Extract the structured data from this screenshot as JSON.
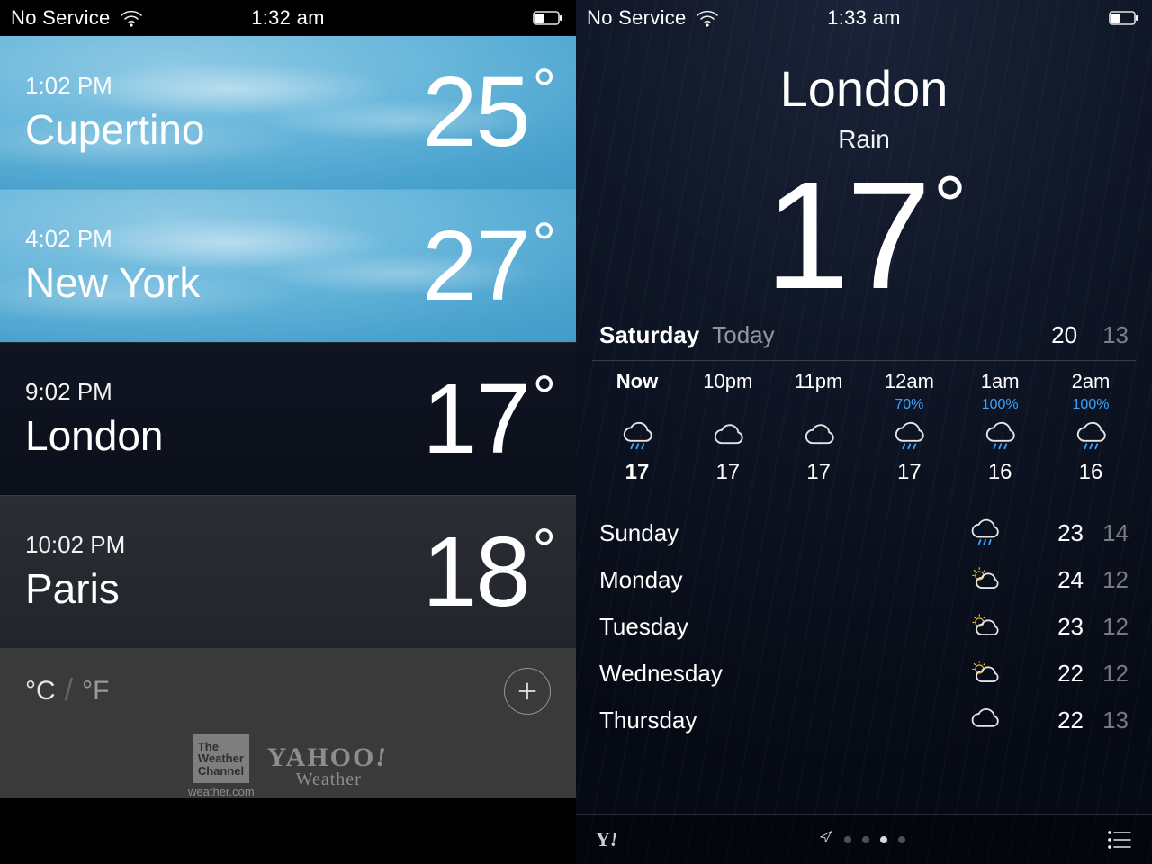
{
  "status_left": {
    "carrier": "No Service",
    "time": "1:32 am"
  },
  "status_right": {
    "carrier": "No Service",
    "time": "1:33 am"
  },
  "list": {
    "cities": [
      {
        "time": "1:02 PM",
        "name": "Cupertino",
        "temp": "25",
        "bg": "sky"
      },
      {
        "time": "4:02 PM",
        "name": "New York",
        "temp": "27",
        "bg": "sky"
      },
      {
        "time": "9:02 PM",
        "name": "London",
        "temp": "17",
        "bg": "dark-rain"
      },
      {
        "time": "10:02 PM",
        "name": "Paris",
        "temp": "18",
        "bg": "dark-cloud"
      }
    ],
    "unit_c": "°C",
    "unit_f": "°F",
    "credits": {
      "twc_line1": "The",
      "twc_line2": "Weather",
      "twc_line3": "Channel",
      "twc_sub": "weather.com",
      "yahoo_top": "YAHOO",
      "yahoo_bang": "!",
      "yahoo_bottom": "Weather"
    }
  },
  "detail": {
    "city": "London",
    "condition": "Rain",
    "temp": "17",
    "today": {
      "day": "Saturday",
      "label": "Today",
      "hi": "20",
      "lo": "13"
    },
    "hourly": [
      {
        "label": "Now",
        "precip": "",
        "icon": "rain",
        "temp": "17",
        "now": true
      },
      {
        "label": "10pm",
        "precip": "",
        "icon": "cloud",
        "temp": "17",
        "now": false
      },
      {
        "label": "11pm",
        "precip": "",
        "icon": "cloud",
        "temp": "17",
        "now": false
      },
      {
        "label": "12am",
        "precip": "70%",
        "icon": "rain",
        "temp": "17",
        "now": false
      },
      {
        "label": "1am",
        "precip": "100%",
        "icon": "rain",
        "temp": "16",
        "now": false
      },
      {
        "label": "2am",
        "precip": "100%",
        "icon": "rain",
        "temp": "16",
        "now": false
      }
    ],
    "daily": [
      {
        "day": "Sunday",
        "icon": "rain",
        "hi": "23",
        "lo": "14"
      },
      {
        "day": "Monday",
        "icon": "partly",
        "hi": "24",
        "lo": "12"
      },
      {
        "day": "Tuesday",
        "icon": "partly",
        "hi": "23",
        "lo": "12"
      },
      {
        "day": "Wednesday",
        "icon": "partly",
        "hi": "22",
        "lo": "12"
      },
      {
        "day": "Thursday",
        "icon": "cloud",
        "hi": "22",
        "lo": "13"
      }
    ],
    "yahoo_y": "Y",
    "yahoo_bang": "!",
    "page_index": 3,
    "page_count": 4
  }
}
